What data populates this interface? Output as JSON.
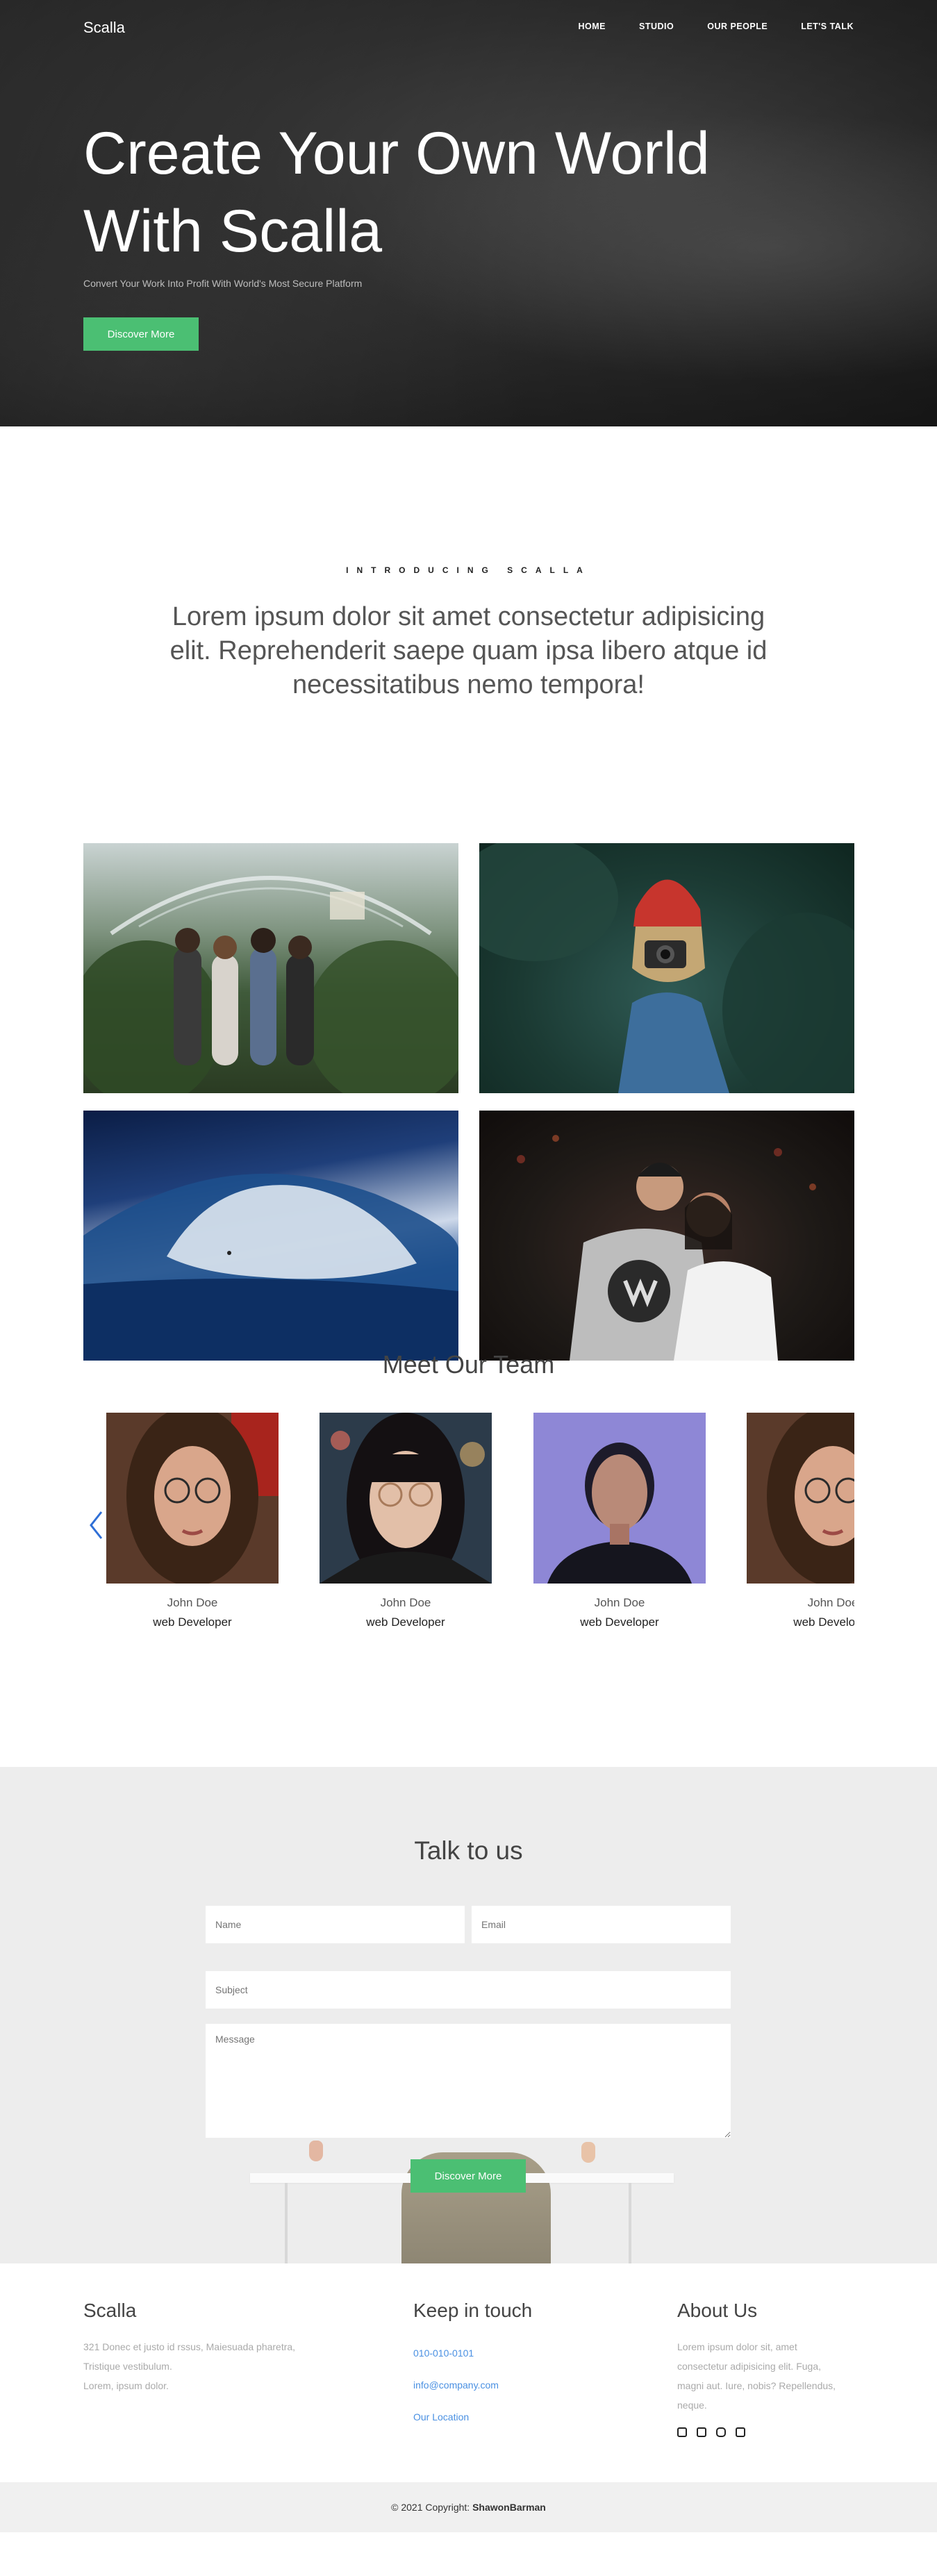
{
  "header": {
    "brand": "Scalla",
    "nav": [
      "HOME",
      "STUDIO",
      "OUR PEOPLE",
      "LET'S TALK"
    ]
  },
  "hero": {
    "title_line1": "Create Your Own World",
    "title_line2": "With Scalla",
    "subtitle": "Convert Your Work Into Profit With World's Most Secure Platform",
    "button": "Discover More"
  },
  "intro": {
    "kicker": "INTRODUCING SCALLA",
    "text": "Lorem ipsum dolor sit amet consectetur adipisicing elit. Reprehenderit saepe quam ipsa libero atque id necessitatibus nemo tempora!"
  },
  "team": {
    "title": "Meet Our Team",
    "members": [
      {
        "name": "John Doe",
        "role": "web Developer"
      },
      {
        "name": "John Doe",
        "role": "web Developer"
      },
      {
        "name": "John Doe",
        "role": "web Developer"
      },
      {
        "name": "John Doe",
        "role": "web Developer"
      }
    ]
  },
  "contact": {
    "title": "Talk to us",
    "name_placeholder": "Name",
    "email_placeholder": "Email",
    "subject_placeholder": "Subject",
    "message_placeholder": "Message",
    "button": "Discover More"
  },
  "footer": {
    "col1": {
      "title": "Scalla",
      "line1": "321 Donec et justo id rssus, Maiesuada pharetra,",
      "line2": "Tristique vestibulum.",
      "line3": "Lorem, ipsum dolor."
    },
    "col2": {
      "title": "Keep in touch",
      "phone": "010-010-0101",
      "email": "info@company.com",
      "location": "Our Location"
    },
    "col3": {
      "title": "About Us",
      "line1": "Lorem ipsum dolor sit, amet",
      "line2": "consectetur adipisicing elit. Fuga,",
      "line3": "magni aut. Iure, nobis? Repellendus,",
      "line4": "neque."
    },
    "social_icons": [
      "twitter-icon",
      "facebook-icon",
      "instagram-icon",
      "linkedin-icon"
    ]
  },
  "copyright": {
    "text": "© 2021 Copyright:",
    "author": "ShawonBarman"
  },
  "colors": {
    "accent": "#4bbf73",
    "link": "#4a90e2",
    "hero_bg": "#2e2e2e",
    "contact_bg": "#ededed"
  }
}
